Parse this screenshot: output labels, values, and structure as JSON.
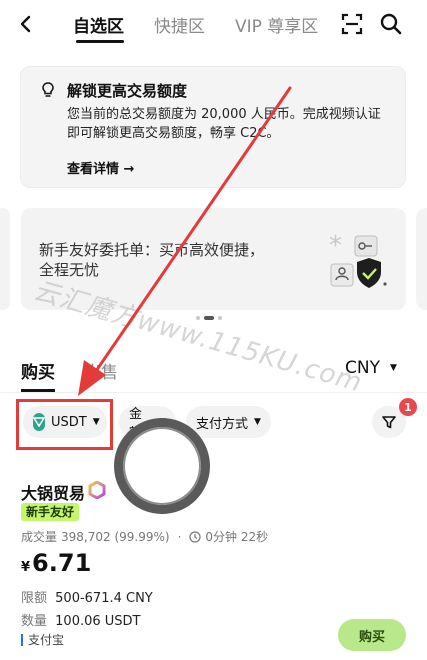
{
  "header": {
    "tabs": [
      {
        "label": "自选区",
        "active": true
      },
      {
        "label": "快捷区",
        "active": false
      },
      {
        "label": "VIP 尊享区",
        "active": false
      }
    ],
    "back_icon": "chevron-left-icon",
    "scan_icon": "scan-icon",
    "search_icon": "search-icon"
  },
  "notice": {
    "icon": "lightbulb-icon",
    "title": "解锁更高交易额度",
    "line1": "您当前的总交易额度为 20,000 人民币。完成视频认证",
    "line2": "即可解锁更高交易额度，畅享 C2C。",
    "link": "查看详情 →"
  },
  "banner": {
    "line1": "新手友好委托单：买币高效便捷，",
    "line2": "全程无忧",
    "carousel_pages": 3,
    "active_page": 1
  },
  "trade_tabs": [
    {
      "label": "购买",
      "active": true
    },
    {
      "label": "出售",
      "active": false
    }
  ],
  "currency": {
    "value": "CNY"
  },
  "filters": {
    "coin": "USDT",
    "amount": "金额",
    "payment": "支付方式",
    "badge_count": "1"
  },
  "listing": {
    "merchant": "大锅贸易",
    "tag": "新手友好",
    "volume_label": "成交量",
    "volume_value": "398,702 (99.99%)",
    "sep": "·",
    "time_value": "0分钟 22秒",
    "price_currency": "¥",
    "price": "6.71",
    "limit_label": "限额",
    "limit_value": "500-671.4 CNY",
    "qty_label": "数量",
    "qty_value": "100.06 USDT",
    "payment": "支付宝",
    "buy_label": "购买"
  },
  "watermark": "云汇魔方www.115KU.com",
  "colors": {
    "annotation": "#e33a3a",
    "accent_green": "#c5f56a",
    "buy_button": "#b9e88a",
    "badge_red": "#e5484d",
    "usdt_green": "#2aa48d"
  }
}
